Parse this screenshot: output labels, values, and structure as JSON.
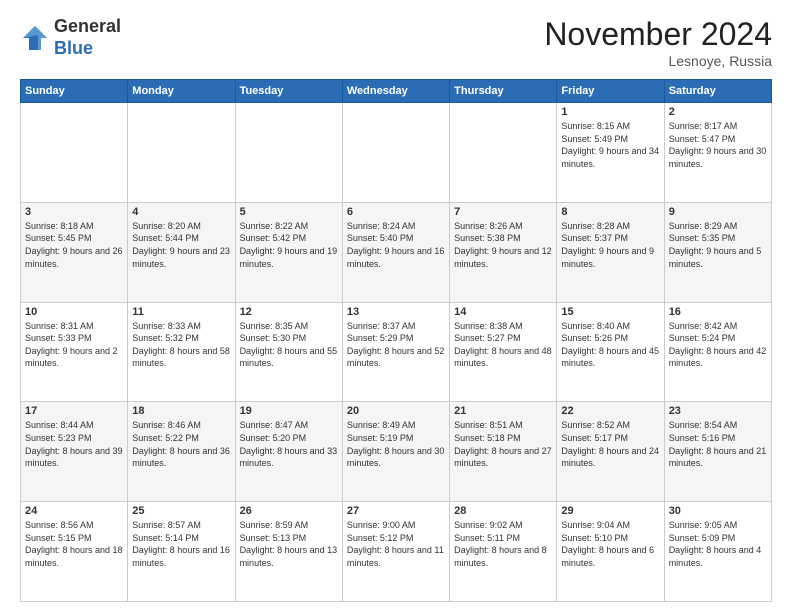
{
  "header": {
    "logo_general": "General",
    "logo_blue": "Blue",
    "month_title": "November 2024",
    "location": "Lesnoye, Russia"
  },
  "days_of_week": [
    "Sunday",
    "Monday",
    "Tuesday",
    "Wednesday",
    "Thursday",
    "Friday",
    "Saturday"
  ],
  "weeks": [
    [
      {
        "day": "",
        "info": ""
      },
      {
        "day": "",
        "info": ""
      },
      {
        "day": "",
        "info": ""
      },
      {
        "day": "",
        "info": ""
      },
      {
        "day": "",
        "info": ""
      },
      {
        "day": "1",
        "info": "Sunrise: 8:15 AM\nSunset: 5:49 PM\nDaylight: 9 hours and 34 minutes."
      },
      {
        "day": "2",
        "info": "Sunrise: 8:17 AM\nSunset: 5:47 PM\nDaylight: 9 hours and 30 minutes."
      }
    ],
    [
      {
        "day": "3",
        "info": "Sunrise: 8:18 AM\nSunset: 5:45 PM\nDaylight: 9 hours and 26 minutes."
      },
      {
        "day": "4",
        "info": "Sunrise: 8:20 AM\nSunset: 5:44 PM\nDaylight: 9 hours and 23 minutes."
      },
      {
        "day": "5",
        "info": "Sunrise: 8:22 AM\nSunset: 5:42 PM\nDaylight: 9 hours and 19 minutes."
      },
      {
        "day": "6",
        "info": "Sunrise: 8:24 AM\nSunset: 5:40 PM\nDaylight: 9 hours and 16 minutes."
      },
      {
        "day": "7",
        "info": "Sunrise: 8:26 AM\nSunset: 5:38 PM\nDaylight: 9 hours and 12 minutes."
      },
      {
        "day": "8",
        "info": "Sunrise: 8:28 AM\nSunset: 5:37 PM\nDaylight: 9 hours and 9 minutes."
      },
      {
        "day": "9",
        "info": "Sunrise: 8:29 AM\nSunset: 5:35 PM\nDaylight: 9 hours and 5 minutes."
      }
    ],
    [
      {
        "day": "10",
        "info": "Sunrise: 8:31 AM\nSunset: 5:33 PM\nDaylight: 9 hours and 2 minutes."
      },
      {
        "day": "11",
        "info": "Sunrise: 8:33 AM\nSunset: 5:32 PM\nDaylight: 8 hours and 58 minutes."
      },
      {
        "day": "12",
        "info": "Sunrise: 8:35 AM\nSunset: 5:30 PM\nDaylight: 8 hours and 55 minutes."
      },
      {
        "day": "13",
        "info": "Sunrise: 8:37 AM\nSunset: 5:29 PM\nDaylight: 8 hours and 52 minutes."
      },
      {
        "day": "14",
        "info": "Sunrise: 8:38 AM\nSunset: 5:27 PM\nDaylight: 8 hours and 48 minutes."
      },
      {
        "day": "15",
        "info": "Sunrise: 8:40 AM\nSunset: 5:26 PM\nDaylight: 8 hours and 45 minutes."
      },
      {
        "day": "16",
        "info": "Sunrise: 8:42 AM\nSunset: 5:24 PM\nDaylight: 8 hours and 42 minutes."
      }
    ],
    [
      {
        "day": "17",
        "info": "Sunrise: 8:44 AM\nSunset: 5:23 PM\nDaylight: 8 hours and 39 minutes."
      },
      {
        "day": "18",
        "info": "Sunrise: 8:46 AM\nSunset: 5:22 PM\nDaylight: 8 hours and 36 minutes."
      },
      {
        "day": "19",
        "info": "Sunrise: 8:47 AM\nSunset: 5:20 PM\nDaylight: 8 hours and 33 minutes."
      },
      {
        "day": "20",
        "info": "Sunrise: 8:49 AM\nSunset: 5:19 PM\nDaylight: 8 hours and 30 minutes."
      },
      {
        "day": "21",
        "info": "Sunrise: 8:51 AM\nSunset: 5:18 PM\nDaylight: 8 hours and 27 minutes."
      },
      {
        "day": "22",
        "info": "Sunrise: 8:52 AM\nSunset: 5:17 PM\nDaylight: 8 hours and 24 minutes."
      },
      {
        "day": "23",
        "info": "Sunrise: 8:54 AM\nSunset: 5:16 PM\nDaylight: 8 hours and 21 minutes."
      }
    ],
    [
      {
        "day": "24",
        "info": "Sunrise: 8:56 AM\nSunset: 5:15 PM\nDaylight: 8 hours and 18 minutes."
      },
      {
        "day": "25",
        "info": "Sunrise: 8:57 AM\nSunset: 5:14 PM\nDaylight: 8 hours and 16 minutes."
      },
      {
        "day": "26",
        "info": "Sunrise: 8:59 AM\nSunset: 5:13 PM\nDaylight: 8 hours and 13 minutes."
      },
      {
        "day": "27",
        "info": "Sunrise: 9:00 AM\nSunset: 5:12 PM\nDaylight: 8 hours and 11 minutes."
      },
      {
        "day": "28",
        "info": "Sunrise: 9:02 AM\nSunset: 5:11 PM\nDaylight: 8 hours and 8 minutes."
      },
      {
        "day": "29",
        "info": "Sunrise: 9:04 AM\nSunset: 5:10 PM\nDaylight: 8 hours and 6 minutes."
      },
      {
        "day": "30",
        "info": "Sunrise: 9:05 AM\nSunset: 5:09 PM\nDaylight: 8 hours and 4 minutes."
      }
    ]
  ]
}
